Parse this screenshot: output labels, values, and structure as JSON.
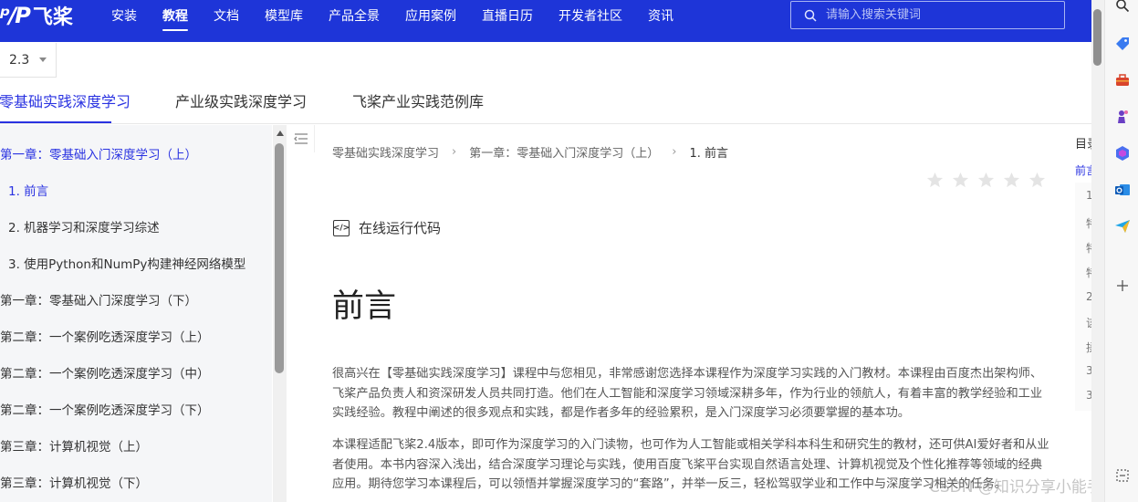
{
  "brand": {
    "logo_mark": "ᵖ/P",
    "name": "飞桨"
  },
  "nav": {
    "items": [
      {
        "label": "安装"
      },
      {
        "label": "教程"
      },
      {
        "label": "文档"
      },
      {
        "label": "模型库"
      },
      {
        "label": "产品全景"
      },
      {
        "label": "应用案例"
      },
      {
        "label": "直播日历"
      },
      {
        "label": "开发者社区"
      },
      {
        "label": "资讯"
      }
    ],
    "active": "教程"
  },
  "search": {
    "placeholder": "请输入搜索关键词",
    "value": ""
  },
  "version": {
    "value": "2.3"
  },
  "course_tabs": [
    "零基础实践深度学习",
    "产业级实践深度学习",
    "飞桨产业实践范例库"
  ],
  "sidebar": {
    "items": [
      {
        "label": "第一章：零基础入门深度学习（上）"
      },
      {
        "label": "1. 前言"
      },
      {
        "label": "2. 机器学习和深度学习综述"
      },
      {
        "label": "3. 使用Python和NumPy构建神经网络模型"
      },
      {
        "label": "第一章：零基础入门深度学习（下）"
      },
      {
        "label": "第二章：一个案例吃透深度学习（上）"
      },
      {
        "label": "第二章：一个案例吃透深度学习（中）"
      },
      {
        "label": "第二章：一个案例吃透深度学习（下）"
      },
      {
        "label": "第三章：计算机视觉（上）"
      },
      {
        "label": "第三章：计算机视觉（下）"
      }
    ]
  },
  "breadcrumb": [
    "零基础实践深度学习",
    "第一章：零基础入门深度学习（上）",
    "1. 前言"
  ],
  "rating": {
    "stars": 5,
    "filled": 0
  },
  "run_code_label": "在线运行代码",
  "page_title": "前言",
  "paragraphs": [
    "很高兴在【零基础实践深度学习】课程中与您相见，非常感谢您选择本课程作为深度学习实践的入门教材。本课程由百度杰出架构师、飞桨产品负责人和资深研发人员共同打造。他们在人工智能和深度学习领域深耕多年，作为行业的领航人，有着丰富的教学经验和工业实践经验。教程中阐述的很多观点和实践，都是作者多年的经验累积，是入门深度学习必须要掌握的基本功。",
    "本课程适配飞桨2.4版本，即可作为深度学习的入门读物，也可作为人工智能或相关学科本科生和研究生的教材，还可供AI爱好者和从业者使用。本书内容深入浅出，结合深度学习理论与实践，使用百度飞桨平台实现自然语言处理、计算机视觉及个性化推荐等领域的经典应用。期待您学习本课程后，可以领悟并掌握深度学习的“套路”，并举一反三，轻松驾驭学业和工作中与深度学习相关的任务。"
  ],
  "toc": {
    "title": "目录",
    "first": "前言",
    "fragments": [
      "1",
      "特",
      "特",
      "特",
      "2",
      "该",
      "揉",
      "3",
      "3"
    ]
  },
  "watermark": "CSDN @知识分享小能手",
  "colors": {
    "brand_blue": "#1e35d8",
    "link_blue": "#2932e1"
  },
  "side_panel_icons": [
    "search-icon",
    "tag-icon",
    "toolbox-icon",
    "chess-icon",
    "copilot-icon",
    "outlook-icon",
    "send-icon",
    "add-icon",
    "screenshot-icon"
  ]
}
